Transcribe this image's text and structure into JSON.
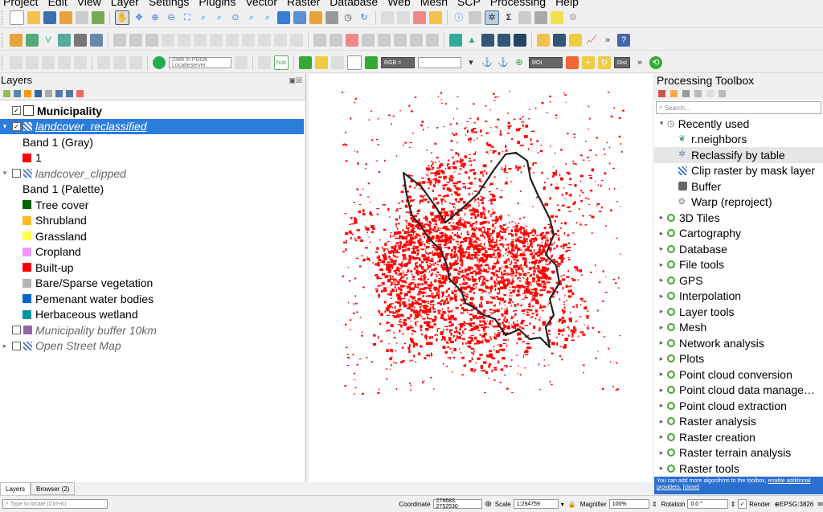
{
  "menu": [
    "Project",
    "Edit",
    "View",
    "Layer",
    "Settings",
    "Plugins",
    "Vector",
    "Raster",
    "Database",
    "Web",
    "Mesh",
    "SCP",
    "Processing",
    "Help"
  ],
  "toolbar": {
    "pdok_search_placeholder": "Zoek in PDOK Locatieserver",
    "rgb_label": "RGB =",
    "roi_label": "ROI",
    "dist_label": "Dist",
    "hub_label": "hub"
  },
  "layers_panel": {
    "title": "Layers",
    "items": [
      {
        "label": "Municipality"
      },
      {
        "label": "landcover_reclassified"
      },
      {
        "label": "Band 1 (Gray)"
      },
      {
        "label": "1"
      },
      {
        "label": "landcover_clipped"
      },
      {
        "label": "Band 1 (Palette)"
      },
      {
        "label": "Tree cover",
        "color": "#006400"
      },
      {
        "label": "Shrubland",
        "color": "#ffbb22"
      },
      {
        "label": "Grassland",
        "color": "#ffff4c"
      },
      {
        "label": "Cropland",
        "color": "#f096ff"
      },
      {
        "label": "Built-up",
        "color": "#fa0000"
      },
      {
        "label": "Bare/Sparse vegetation",
        "color": "#b4b4b4"
      },
      {
        "label": "Pemenant water bodies",
        "color": "#0064c8"
      },
      {
        "label": "Herbaceous wetland",
        "color": "#0096a0"
      },
      {
        "label": "Municipality buffer 10km",
        "color": "#9467a8"
      },
      {
        "label": "Open Street Map"
      }
    ]
  },
  "processing": {
    "title": "Processing Toolbox",
    "search_placeholder": "Search…",
    "recent_group": "Recently used",
    "recent": [
      "r.neighbors",
      "Reclassify by table",
      "Clip raster by mask layer",
      "Buffer",
      "Warp (reproject)"
    ],
    "groups": [
      "3D Tiles",
      "Cartography",
      "Database",
      "File tools",
      "GPS",
      "Interpolation",
      "Layer tools",
      "Mesh",
      "Network analysis",
      "Plots",
      "Point cloud conversion",
      "Point cloud data manage…",
      "Point cloud extraction",
      "Raster analysis",
      "Raster creation",
      "Raster terrain analysis",
      "Raster tools"
    ],
    "info_text": "You can add more algorithms to the toolbox, ",
    "info_link": "enable additional providers.",
    "info_close": "[close]"
  },
  "bottom_tabs": [
    "Layers",
    "Browser (2)"
  ],
  "status": {
    "locate_placeholder": "Type to locate (Ctrl+K)",
    "coordinate_label": "Coordinate",
    "coordinate_value": "278683, 2752530",
    "scale_label": "Scale",
    "scale_value": "1:294759",
    "magnifier_label": "Magnifier",
    "magnifier_value": "100%",
    "rotation_label": "Rotation",
    "rotation_value": "0.0 °",
    "render_label": "Render",
    "crs_label": "EPSG:3826"
  },
  "colors": {
    "accent": "#2b7ddb",
    "builtup": "#ff0000",
    "qgis_green": "#4aa335"
  }
}
